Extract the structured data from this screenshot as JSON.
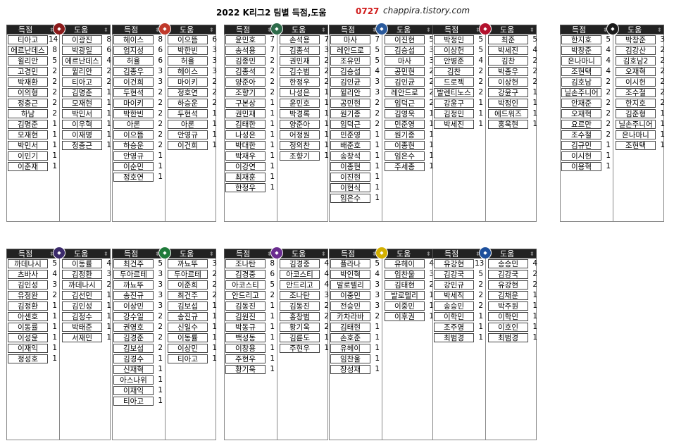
{
  "header": {
    "title": "2022 K리그2 팀별 득점,도움",
    "date_code": "0727",
    "blog": "chappira.tistory.com"
  },
  "labels": {
    "goals": "득점",
    "assists": "도움"
  },
  "teams": [
    {
      "emblem": "club-crest-1",
      "color": "#8b1a1a",
      "goals": [
        [
          "티아고",
          "14"
        ],
        [
          "에르난데스",
          "8"
        ],
        [
          "윌리안",
          "5"
        ],
        [
          "고경민",
          "2"
        ],
        [
          "박재환",
          "2"
        ],
        [
          "이의형",
          "2"
        ],
        [
          "정충근",
          "2"
        ],
        [
          "하남",
          "2"
        ],
        [
          "김명준",
          "1"
        ],
        [
          "모재현",
          "1"
        ],
        [
          "박민서",
          "1"
        ],
        [
          "이민기",
          "1"
        ],
        [
          "이준재",
          "1"
        ]
      ],
      "assists": [
        [
          "이광진",
          "8"
        ],
        [
          "박광일",
          "6"
        ],
        [
          "에르난데스",
          "4"
        ],
        [
          "윌리안",
          "2"
        ],
        [
          "티아고",
          "2"
        ],
        [
          "김명준",
          "1"
        ],
        [
          "모재현",
          "1"
        ],
        [
          "박민서",
          "1"
        ],
        [
          "이우혁",
          "1"
        ],
        [
          "이재명",
          "1"
        ],
        [
          "정충근",
          "1"
        ]
      ]
    },
    {
      "emblem": "club-crest-2",
      "color": "#c0392b",
      "goals": [
        [
          "헤이스",
          "8"
        ],
        [
          "엄지성",
          "6"
        ],
        [
          "허율",
          "6"
        ],
        [
          "김종우",
          "3"
        ],
        [
          "이건희",
          "3"
        ],
        [
          "두현석",
          "2"
        ],
        [
          "마이키",
          "2"
        ],
        [
          "박한빈",
          "2"
        ],
        [
          "아론",
          "2"
        ],
        [
          "이으뜸",
          "2"
        ],
        [
          "하승운",
          "2"
        ],
        [
          "안영규",
          "1"
        ],
        [
          "이순민",
          "1"
        ],
        [
          "정호연",
          "1"
        ]
      ],
      "assists": [
        [
          "이으뜸",
          "6"
        ],
        [
          "박한빈",
          "3"
        ],
        [
          "허율",
          "3"
        ],
        [
          "헤이스",
          "3"
        ],
        [
          "마이키",
          "2"
        ],
        [
          "정호연",
          "2"
        ],
        [
          "하승운",
          "2"
        ],
        [
          "두현석",
          "1"
        ],
        [
          "아론",
          "1"
        ],
        [
          "안영규",
          "1"
        ],
        [
          "이건희",
          "1"
        ]
      ]
    },
    {
      "emblem": "club-crest-3",
      "color": "#2e6b4a",
      "goals": [
        [
          "윤민호",
          "7"
        ],
        [
          "송석용",
          "7"
        ],
        [
          "김종민",
          "2"
        ],
        [
          "김종석",
          "2"
        ],
        [
          "양준아",
          "2"
        ],
        [
          "조향기",
          "2"
        ],
        [
          "구본상",
          "1"
        ],
        [
          "권민재",
          "1"
        ],
        [
          "김태한",
          "1"
        ],
        [
          "나성은",
          "1"
        ],
        [
          "박대한",
          "1"
        ],
        [
          "박재우",
          "1"
        ],
        [
          "이강연",
          "1"
        ],
        [
          "최재훈",
          "1"
        ],
        [
          "한정우",
          "1"
        ]
      ],
      "assists": [
        [
          "손석용",
          "7"
        ],
        [
          "김종석",
          "3"
        ],
        [
          "권민재",
          "2"
        ],
        [
          "김수범",
          "2"
        ],
        [
          "한정우",
          "2"
        ],
        [
          "나성은",
          "1"
        ],
        [
          "윤민호",
          "1"
        ],
        [
          "박경록",
          "1"
        ],
        [
          "양준아",
          "1"
        ],
        [
          "어정원",
          "1"
        ],
        [
          "정의찬",
          "1"
        ],
        [
          "조향기",
          "1"
        ]
      ]
    },
    {
      "emblem": "club-crest-4",
      "color": "#2a5a9c",
      "goals": [
        [
          "마사",
          "7"
        ],
        [
          "레안드로",
          "5"
        ],
        [
          "조유민",
          "5"
        ],
        [
          "김승섭",
          "4"
        ],
        [
          "김인균",
          "3"
        ],
        [
          "윌리안",
          "3"
        ],
        [
          "공민현",
          "2"
        ],
        [
          "원기종",
          "2"
        ],
        [
          "임덕근",
          "2"
        ],
        [
          "민준영",
          "1"
        ],
        [
          "배준호",
          "1"
        ],
        [
          "송창석",
          "1"
        ],
        [
          "이종현",
          "1"
        ],
        [
          "이진현",
          "1"
        ],
        [
          "이현식",
          "1"
        ],
        [
          "임은수",
          "1"
        ]
      ],
      "assists": [
        [
          "이진현",
          "5"
        ],
        [
          "김승섭",
          "3"
        ],
        [
          "마사",
          "3"
        ],
        [
          "공민현",
          "2"
        ],
        [
          "김인균",
          "2"
        ],
        [
          "레안드로",
          "2"
        ],
        [
          "임덕근",
          "2"
        ],
        [
          "김영욱",
          "1"
        ],
        [
          "민준영",
          "1"
        ],
        [
          "원기종",
          "1"
        ],
        [
          "이종현",
          "1"
        ],
        [
          "임은수",
          "1"
        ],
        [
          "주세종",
          "1"
        ]
      ]
    },
    {
      "emblem": "club-crest-5",
      "color": "#b3122e",
      "goals": [
        [
          "박정인",
          "5"
        ],
        [
          "이상헌",
          "5"
        ],
        [
          "안병준",
          "4"
        ],
        [
          "김찬",
          "2"
        ],
        [
          "드로젝",
          "2"
        ],
        [
          "발렌티노스",
          "2"
        ],
        [
          "강윤구",
          "1"
        ],
        [
          "김정민",
          "1"
        ],
        [
          "박세진",
          "1"
        ]
      ],
      "assists": [
        [
          "최준",
          "5"
        ],
        [
          "박세진",
          "4"
        ],
        [
          "김찬",
          "2"
        ],
        [
          "박종우",
          "2"
        ],
        [
          "이상헌",
          "2"
        ],
        [
          "강윤구",
          "1"
        ],
        [
          "박정인",
          "1"
        ],
        [
          "에드워즈",
          "1"
        ],
        [
          "홍욱현",
          "1"
        ]
      ]
    },
    {
      "emblem": "club-crest-6",
      "color": "#1a1a1a",
      "goals": [
        [
          "한지호",
          "5"
        ],
        [
          "박창준",
          "4"
        ],
        [
          "은나마니",
          "4"
        ],
        [
          "조현택",
          "4"
        ],
        [
          "김호남",
          "2"
        ],
        [
          "닐손주니어",
          "2"
        ],
        [
          "안재준",
          "2"
        ],
        [
          "오재혁",
          "2"
        ],
        [
          "요르만",
          "2"
        ],
        [
          "조수철",
          "2"
        ],
        [
          "김규민",
          "1"
        ],
        [
          "이시헌",
          "1"
        ],
        [
          "이용혁",
          "1"
        ]
      ],
      "assists": [
        [
          "박창준",
          "3"
        ],
        [
          "김강산",
          "2"
        ],
        [
          "김호남2",
          "2"
        ],
        [
          "오재혁",
          "2"
        ],
        [
          "이시헌",
          "2"
        ],
        [
          "조수철",
          "2"
        ],
        [
          "한지호",
          "2"
        ],
        [
          "김준형",
          "1"
        ],
        [
          "닐손주니어",
          "1"
        ],
        [
          "은나마니",
          "1"
        ],
        [
          "조현택",
          "1"
        ]
      ]
    },
    {
      "emblem": "club-crest-7",
      "color": "#3b2a6b",
      "goals": [
        [
          "까데나시",
          "5"
        ],
        [
          "츠바사",
          "4"
        ],
        [
          "김인성",
          "3"
        ],
        [
          "유정완",
          "2"
        ],
        [
          "김정환",
          "1"
        ],
        [
          "아센호",
          "1"
        ],
        [
          "이동률",
          "1"
        ],
        [
          "이성윤",
          "1"
        ],
        [
          "이재익",
          "1"
        ],
        [
          "정성호",
          "1"
        ]
      ],
      "assists": [
        [
          "이동률",
          "4"
        ],
        [
          "김정환",
          "3"
        ],
        [
          "까데나시",
          "2"
        ],
        [
          "김선민",
          "1"
        ],
        [
          "김인성",
          "1"
        ],
        [
          "김정수",
          "1"
        ],
        [
          "박태준",
          "1"
        ],
        [
          "서재민",
          "1"
        ]
      ]
    },
    {
      "emblem": "club-crest-8",
      "color": "#1f7a3a",
      "goals": [
        [
          "최건주",
          "5"
        ],
        [
          "두아르테",
          "3"
        ],
        [
          "까뇨뚜",
          "3"
        ],
        [
          "송진규",
          "3"
        ],
        [
          "이상민",
          "3"
        ],
        [
          "강수일",
          "2"
        ],
        [
          "권영호",
          "2"
        ],
        [
          "김경준",
          "2"
        ],
        [
          "김보섭",
          "2"
        ],
        [
          "김경수",
          "1"
        ],
        [
          "신재혁",
          "1"
        ],
        [
          "아스나위",
          "1"
        ],
        [
          "이재익",
          "1"
        ],
        [
          "티아고",
          "1"
        ]
      ],
      "assists": [
        [
          "까뇨뚜",
          "3"
        ],
        [
          "두아르테",
          "2"
        ],
        [
          "이준희",
          "2"
        ],
        [
          "최건주",
          "2"
        ],
        [
          "김보섭",
          "1"
        ],
        [
          "송진규",
          "1"
        ],
        [
          "신일수",
          "1"
        ],
        [
          "이동률",
          "1"
        ],
        [
          "이상민",
          "1"
        ],
        [
          "티아고",
          "1"
        ]
      ]
    },
    {
      "emblem": "club-crest-9",
      "color": "#6a2c8f",
      "goals": [
        [
          "조나탄",
          "8"
        ],
        [
          "김경중",
          "6"
        ],
        [
          "아코스티",
          "5"
        ],
        [
          "안드리고",
          "2"
        ],
        [
          "김동진",
          "1"
        ],
        [
          "김원진",
          "1"
        ],
        [
          "박동규",
          "1"
        ],
        [
          "백성동",
          "1"
        ],
        [
          "이창용",
          "1"
        ],
        [
          "주현우",
          "1"
        ],
        [
          "황기욱",
          "1"
        ]
      ],
      "assists": [
        [
          "김경중",
          "4"
        ],
        [
          "아코스티",
          "4"
        ],
        [
          "안드리고",
          "4"
        ],
        [
          "조나탄",
          "3"
        ],
        [
          "김동진",
          "2"
        ],
        [
          "홍창범",
          "2"
        ],
        [
          "황기욱",
          "2"
        ],
        [
          "김륜도",
          "1"
        ],
        [
          "주현우",
          "1"
        ]
      ]
    },
    {
      "emblem": "club-crest-10",
      "color": "#d4b000",
      "goals": [
        [
          "플라나",
          "5"
        ],
        [
          "박인혁",
          "4"
        ],
        [
          "발로텔리",
          "3"
        ],
        [
          "이중민",
          "3"
        ],
        [
          "전승민",
          "3"
        ],
        [
          "카차라바",
          "2"
        ],
        [
          "김태현",
          "1"
        ],
        [
          "손호준",
          "1"
        ],
        [
          "유헤이",
          "1"
        ],
        [
          "임찬울",
          "1"
        ],
        [
          "장성재",
          "1"
        ]
      ],
      "assists": [
        [
          "유헤이",
          "4"
        ],
        [
          "임찬울",
          "3"
        ],
        [
          "김태현",
          "2"
        ],
        [
          "발로텔리",
          "1"
        ],
        [
          "이중민",
          "1"
        ],
        [
          "이후권",
          "1"
        ]
      ]
    },
    {
      "emblem": "club-crest-11",
      "color": "#1d4f9c",
      "goals": [
        [
          "유강현",
          "13"
        ],
        [
          "김강국",
          "5"
        ],
        [
          "강민규",
          "2"
        ],
        [
          "박세직",
          "2"
        ],
        [
          "송승민",
          "2"
        ],
        [
          "이학민",
          "1"
        ],
        [
          "조주영",
          "1"
        ],
        [
          "최범경",
          "1"
        ]
      ],
      "assists": [
        [
          "송승민",
          "4"
        ],
        [
          "김강국",
          "2"
        ],
        [
          "유강현",
          "2"
        ],
        [
          "김채운",
          "1"
        ],
        [
          "박주원",
          "1"
        ],
        [
          "이학민",
          "1"
        ],
        [
          "이호인",
          "1"
        ],
        [
          "최범경",
          "1"
        ]
      ]
    }
  ]
}
